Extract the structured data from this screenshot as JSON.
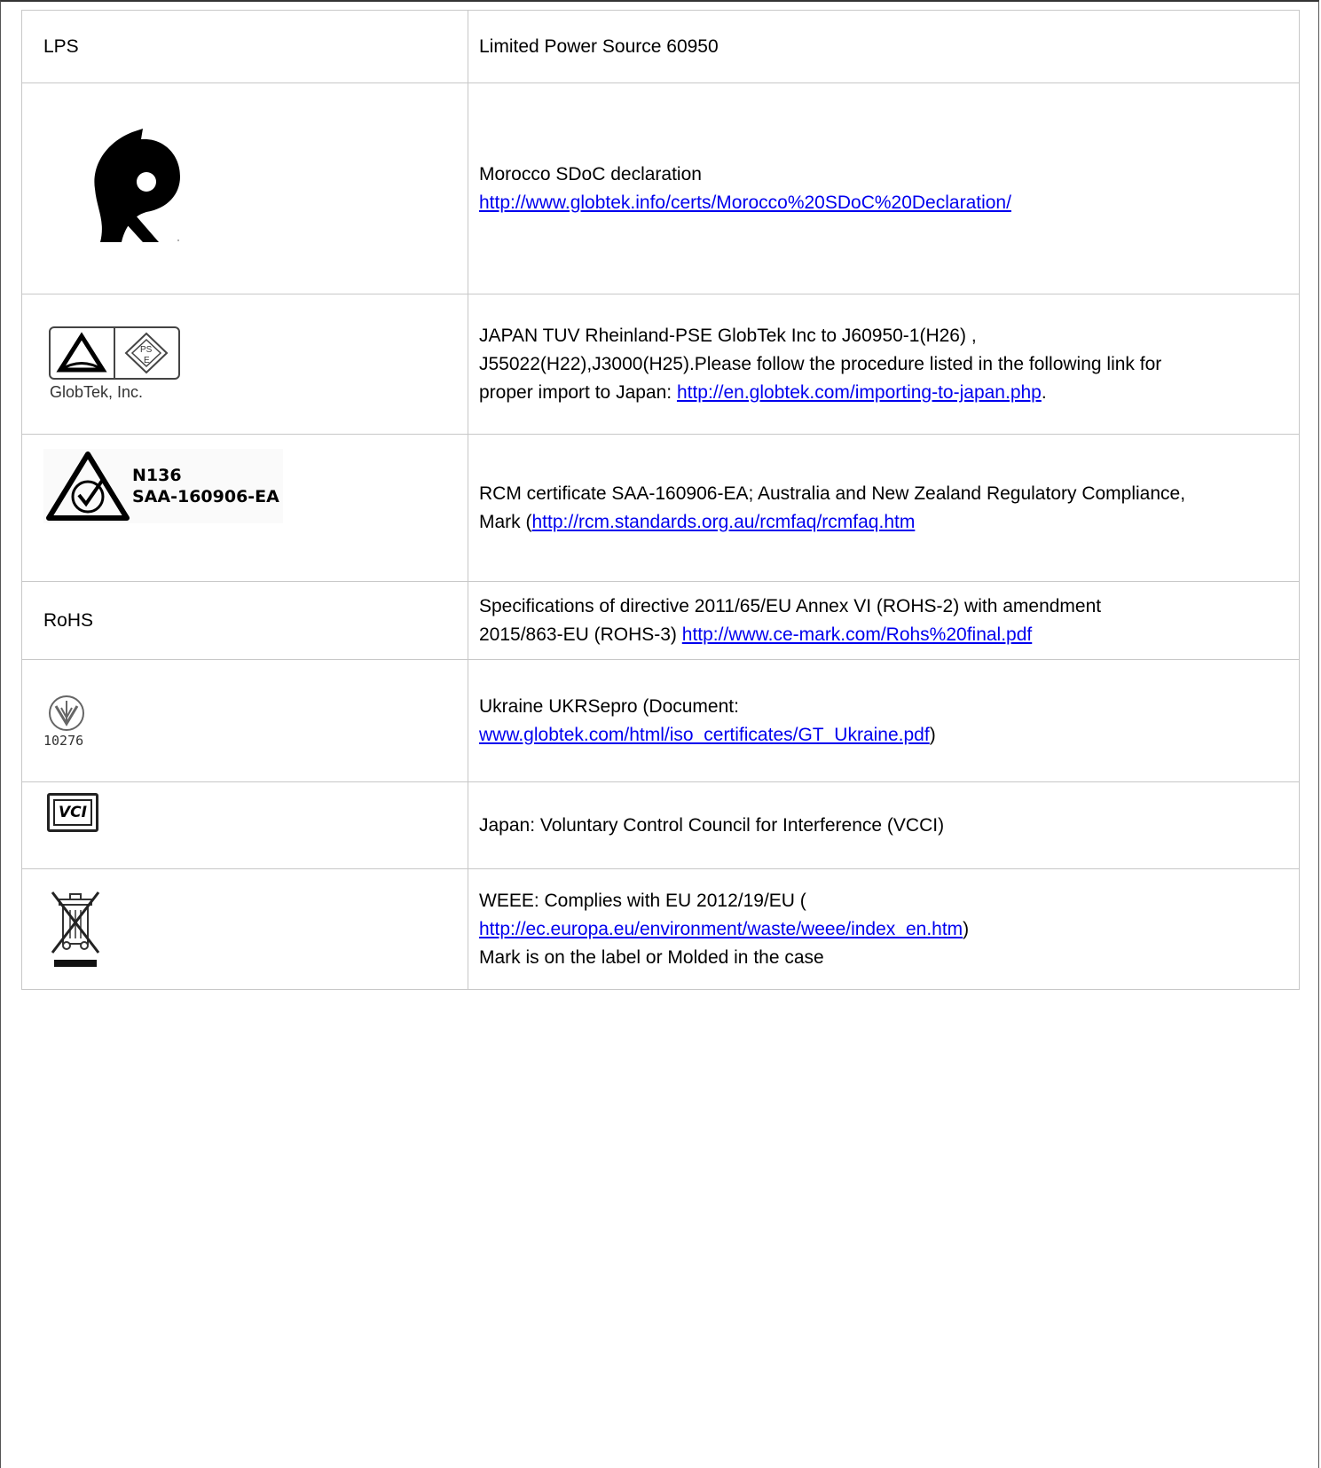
{
  "rows": [
    {
      "mark_text": "LPS",
      "desc": "Limited Power Source 60950"
    },
    {
      "mark_icon": "ccc-morocco-icon",
      "desc_line1": "Morocco SDoC declaration",
      "link": "http://www.globtek.info/certs/Morocco%20SDoC%20Declaration/"
    },
    {
      "mark_icon": "tuv-pse-icon",
      "mark_caption": "GlobTek, Inc.",
      "desc_line1": "JAPAN TUV Rheinland-PSE GlobTek Inc to J60950-1(H26) ,",
      "desc_line2": "J55022(H22),J3000(H25).Please follow the procedure listed in the following link for",
      "desc_line3_prefix": "proper import to Japan: ",
      "link": "http://en.globtek.com/importing-to-japan.php",
      "desc_line3_suffix": "."
    },
    {
      "mark_icon": "rcm-icon",
      "mark_line1": "N136",
      "mark_line2": "SAA-160906-EA",
      "desc_line1": "RCM certificate SAA-160906-EA; Australia and New Zealand Regulatory Compliance,",
      "desc_line2_prefix": "Mark (",
      "link": "http://rcm.standards.org.au/rcmfaq/rcmfaq.htm"
    },
    {
      "mark_text": "RoHS",
      "desc_line1": "Specifications of directive 2011/65/EU Annex VI (ROHS-2) with amendment",
      "desc_line2_prefix": "2015/863-EU (ROHS-3) ",
      "link": "http://www.ce-mark.com/Rohs%20final.pdf"
    },
    {
      "mark_icon": "ukrsepro-icon",
      "mark_caption": "10276",
      "desc_line1": "Ukraine UKRSepro (Document:",
      "link": "www.globtek.com/html/iso_certificates/GT_Ukraine.pdf",
      "desc_line2_suffix": ")"
    },
    {
      "mark_icon": "vcci-icon",
      "mark_caption": "VCI",
      "desc": "Japan: Voluntary Control Council for Interference (VCCI)"
    },
    {
      "mark_icon": "weee-bin-icon",
      "desc_line1": "WEEE: Complies with EU 2012/19/EU (",
      "link": "http://ec.europa.eu/environment/waste/weee/index_en.htm",
      "desc_line2_suffix": ")",
      "desc_line3": "Mark is on the label or Molded in the case"
    }
  ]
}
